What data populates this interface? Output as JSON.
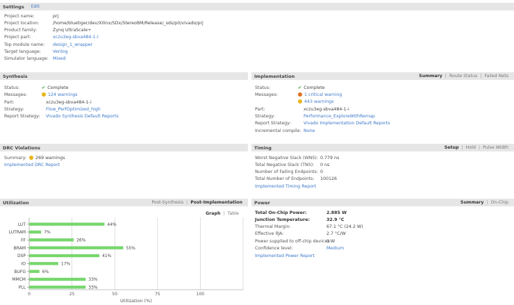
{
  "settings": {
    "title": "Settings",
    "edit": "Edit",
    "rows": [
      {
        "label": "Project name:",
        "value": "prj"
      },
      {
        "label": "Project location:",
        "value": "/home/bluetiger/dev/Xilinx/SDx/StereoBM/Release/_sds/p0/vivado/prj"
      },
      {
        "label": "Product family:",
        "value": "Zynq UltraScale+"
      },
      {
        "label": "Project part:",
        "value": "xczu3eg-sbva484-1-i"
      },
      {
        "label": "Top module name:",
        "value": "design_1_wrapper"
      },
      {
        "label": "Target language:",
        "value": "Verilog"
      },
      {
        "label": "Simulator language:",
        "value": "Mixed"
      }
    ]
  },
  "synthesis": {
    "title": "Synthesis",
    "status_label": "Status:",
    "status": "Complete",
    "messages_label": "Messages:",
    "messages": "124 warnings",
    "part_label": "Part:",
    "part": "xczu3eg-sbva484-1-i",
    "strategy_label": "Strategy:",
    "strategy": "Flow_PerfOptimized_high",
    "report_label": "Report Strategy:",
    "report": "Vivado Synthesis Default Reports"
  },
  "implementation": {
    "title": "Implementation",
    "tabs": [
      "Summary",
      "Route Status",
      "Failed Nets"
    ],
    "status_label": "Status:",
    "status": "Complete",
    "messages_label": "Messages:",
    "critical": "1 critical warning",
    "warnings": "443 warnings",
    "part_label": "Part:",
    "part": "xczu3eg-sbva484-1-i",
    "strategy_label": "Strategy:",
    "strategy": "Performance_ExploreWithRemap",
    "report_label": "Report Strategy:",
    "report": "Vivado Implementation Default Reports",
    "incremental_label": "Incremental compile:",
    "incremental": "None"
  },
  "drc": {
    "title": "DRC Violations",
    "summary_label": "Summary:",
    "summary": "269 warnings",
    "report": "Implemented DRC Report"
  },
  "timing": {
    "title": "Timing",
    "tabs": [
      "Setup",
      "Hold",
      "Pulse Width"
    ],
    "rows": [
      {
        "label": "Worst Negative Slack (WNS):",
        "value": "0.779 ns"
      },
      {
        "label": "Total Negative Slack (TNS):",
        "value": "0 ns"
      },
      {
        "label": "Number of Failing Endpoints:",
        "value": "0"
      },
      {
        "label": "Total Number of Endpoints:",
        "value": "100126"
      }
    ],
    "report": "Implemented Timing Report"
  },
  "utilization": {
    "title": "Utilization",
    "tabs": [
      "Post-Synthesis",
      "Post-Implementation"
    ],
    "view_tabs": [
      "Graph",
      "Table"
    ]
  },
  "power": {
    "title": "Power",
    "tabs": [
      "Summary",
      "On-Chip"
    ],
    "rows": [
      {
        "label": "Total On-Chip Power:",
        "value": "2.885 W"
      },
      {
        "label": "Junction Temperature:",
        "value": "32.9 °C"
      },
      {
        "label": "Thermal Margin:",
        "value": "67.1 °C (24.2 W)"
      },
      {
        "label": "Effective ϑJA:",
        "value": "2.7 °C/W"
      },
      {
        "label": "Power supplied to off-chip devices:",
        "value": "0 W"
      },
      {
        "label": "Confidence level:",
        "value": "Medium"
      }
    ],
    "report": "Implemented Power Report"
  },
  "colors": {
    "accent": "#3c78c8",
    "bar": "#78d66e",
    "header": "#e6e6e6"
  },
  "chart_data": {
    "type": "bar",
    "orientation": "horizontal",
    "categories": [
      "LUT",
      "LUTRAM",
      "FF",
      "BRAM",
      "DSP",
      "IO",
      "BUFG",
      "MMCM",
      "PLL"
    ],
    "values": [
      44,
      7,
      26,
      55,
      41,
      17,
      6,
      33,
      33
    ],
    "value_labels": [
      "44%",
      "7%",
      "26%",
      "55%",
      "41%",
      "17%",
      "6%",
      "33%",
      "33%"
    ],
    "xlabel": "Utilization (%)",
    "xticks": [
      "0",
      "25",
      "50",
      "75",
      "100"
    ],
    "xlim": [
      0,
      125
    ],
    "grid": true
  }
}
